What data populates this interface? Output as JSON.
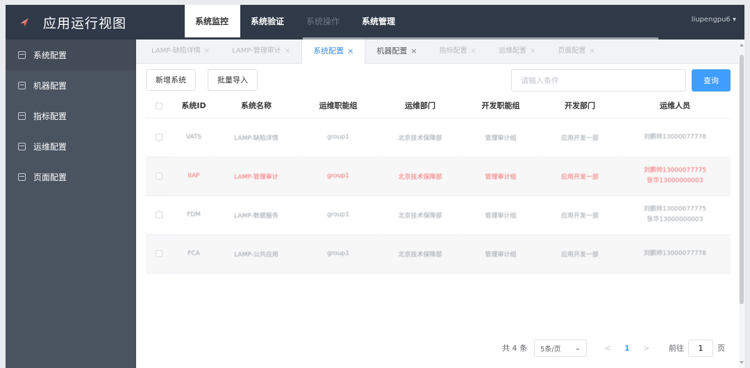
{
  "app": {
    "title": "应用运行视图",
    "user": "liupengpu6"
  },
  "menu": [
    "系统监控",
    "系统验证",
    "系统操作",
    "系统管理"
  ],
  "sidebar": [
    "系统配置",
    "机器配置",
    "指标配置",
    "运维配置",
    "页面配置"
  ],
  "tabs": [
    "LAMP-缺陷详情",
    "LAMP-管理审计",
    "系统配置",
    "机器配置",
    "指标配置",
    "运维配置",
    "页面配置"
  ],
  "toolbar": {
    "add": "新增系统",
    "import": "批量导入",
    "search_placeholder": "请输入条件",
    "query": "查询"
  },
  "table": {
    "headers": [
      "系统ID",
      "系统名称",
      "运维职能组",
      "运维部门",
      "开发职能组",
      "开发部门",
      "运维人员"
    ],
    "rows": [
      {
        "id": "VATS",
        "name": "LAMP-缺陷详情",
        "ops_group": "group1",
        "ops_dept": "北京技术保障部",
        "dev_group": "管理审计组",
        "dev_dept": "应用开发一部",
        "staff1": "刘鹏帅13000077778",
        "staff2": ""
      },
      {
        "id": "IIAP",
        "name": "LAMP-管理审计",
        "ops_group": "group1",
        "ops_dept": "北京技术保障部",
        "dev_group": "管理审计组",
        "dev_dept": "应用开发一部",
        "staff1": "刘鹏帅13000077775",
        "staff2": "张华13000000003"
      },
      {
        "id": "FDM",
        "name": "LAMP-数据服务",
        "ops_group": "group1",
        "ops_dept": "北京技术保障部",
        "dev_group": "管理审计组",
        "dev_dept": "应用开发一部",
        "staff1": "刘鹏帅13000077775",
        "staff2": "张华13000000003"
      },
      {
        "id": "FCA",
        "name": "LAMP-公共应用",
        "ops_group": "group1",
        "ops_dept": "北京技术保障部",
        "dev_group": "管理审计组",
        "dev_dept": "应用开发一部",
        "staff1": "刘鹏帅13000077778",
        "staff2": ""
      }
    ]
  },
  "pager": {
    "total": "共 4 条",
    "size": "5条/页",
    "prev": "<",
    "current": "1",
    "next": ">",
    "goto": "前往",
    "page_value": "1",
    "unit": "页"
  },
  "colors": {
    "header": "#2f3948",
    "sidebar": "#4a5360",
    "primary": "#409eff",
    "danger": "#f56c6c"
  },
  "icons": {
    "logo": "paper-plane-icon",
    "sidebar": "printer-icon",
    "dropdown": "caret-down-icon",
    "tab_close": "close-icon"
  }
}
